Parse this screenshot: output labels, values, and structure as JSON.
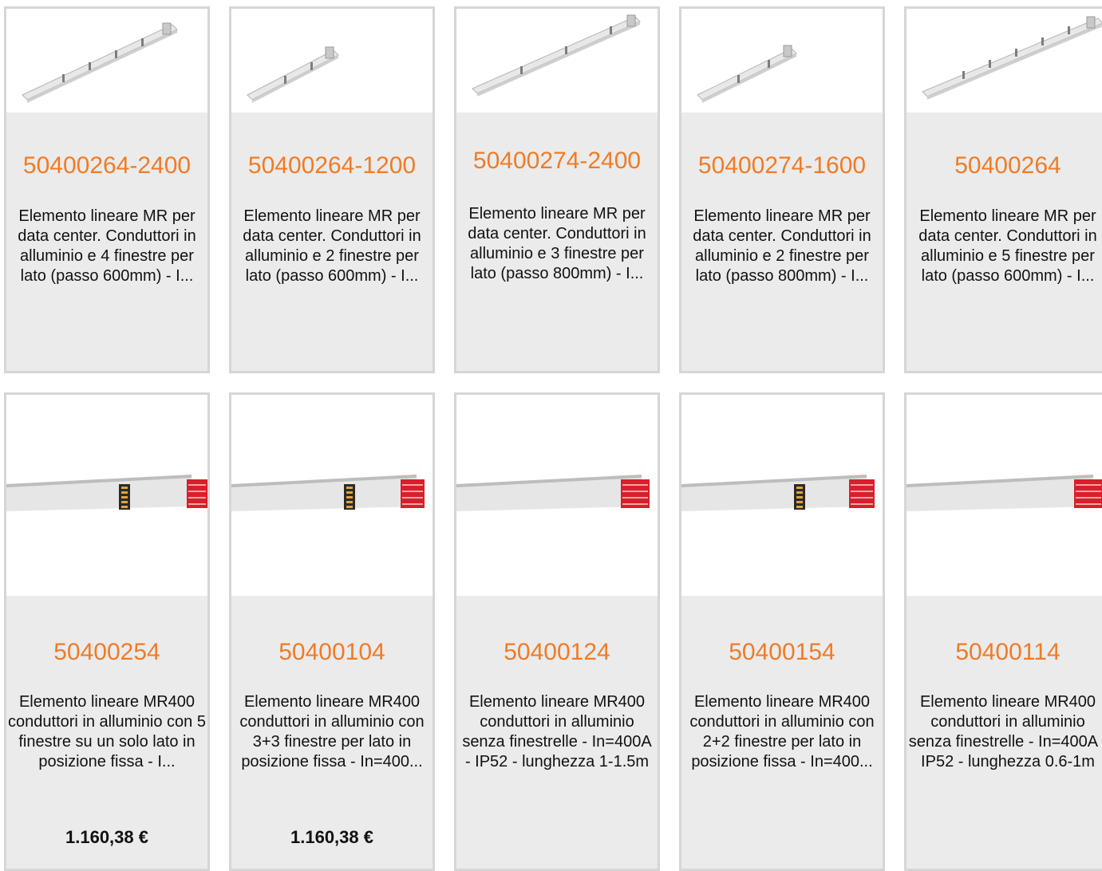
{
  "products_top": [
    {
      "code": "50400264-2400",
      "description": "Elemento lineare MR per data center. Conduttori in alluminio e 4 finestre per lato (passo 600mm) - I...",
      "image": "busbar-long-icon"
    },
    {
      "code": "50400264-1200",
      "description": "Elemento lineare MR per data center. Conduttori in alluminio e 2 finestre per lato (passo 600mm) - I...",
      "image": "busbar-short-icon"
    },
    {
      "code": "50400274-2400",
      "description": "Elemento lineare MR per data center. Conduttori in alluminio e 3 finestre per lato (passo 800mm) - I...",
      "image": "busbar-long-icon"
    },
    {
      "code": "50400274-1600",
      "description": "Elemento lineare MR per data center. Conduttori in alluminio e 2 finestre per lato (passo 800mm) - I...",
      "image": "busbar-short-icon"
    },
    {
      "code": "50400264",
      "description": "Elemento lineare MR per data center. Conduttori in alluminio e 5 finestre per lato (passo 600mm) - I...",
      "image": "busbar-long-icon"
    }
  ],
  "products_bottom": [
    {
      "code": "50400254",
      "description": "Elemento lineare MR400 conduttori in alluminio con 5 finestre su un solo lato in posizione fissa - I...",
      "price": "1.160,38 €",
      "image": "busbar-window-icon"
    },
    {
      "code": "50400104",
      "description": "Elemento lineare MR400 conduttori in alluminio con 3+3 finestre per lato in posizione fissa - In=400...",
      "price": "1.160,38 €",
      "image": "busbar-window-icon"
    },
    {
      "code": "50400124",
      "description": "Elemento lineare MR400 conduttori in alluminio senza finestrelle - In=400A - IP52 - lunghezza 1-1.5m",
      "price": "",
      "image": "busbar-plain-icon"
    },
    {
      "code": "50400154",
      "description": "Elemento lineare MR400 conduttori in alluminio con 2+2 finestre per lato in posizione fissa - In=400...",
      "price": "",
      "image": "busbar-window-icon"
    },
    {
      "code": "50400114",
      "description": "Elemento lineare MR400 conduttori in alluminio senza finestrelle - In=400A - IP52 - lunghezza 0.6-1m",
      "price": "",
      "image": "busbar-plain-icon"
    }
  ],
  "colors": {
    "accent": "#f07b26",
    "card_bg": "#ebebeb",
    "border": "#d6d6d6",
    "connector_red": "#d81f2a"
  }
}
